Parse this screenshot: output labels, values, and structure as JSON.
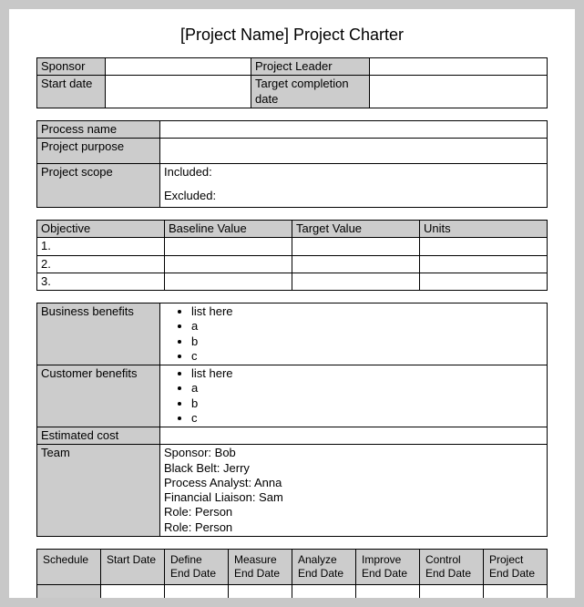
{
  "title": "[Project Name] Project Charter",
  "info": {
    "sponsorLabel": "Sponsor",
    "sponsor": "",
    "projectLeaderLabel": "Project Leader",
    "projectLeader": "",
    "startDateLabel": "Start date",
    "startDate": "",
    "targetCompletionLabel": "Target completion date",
    "targetCompletion": ""
  },
  "process": {
    "nameLabel": "Process name",
    "name": "",
    "purposeLabel": "Project purpose",
    "purpose": "",
    "scopeLabel": "Project scope",
    "includedLabel": "Included:",
    "excludedLabel": "Excluded:"
  },
  "objectives": {
    "headers": {
      "objective": "Objective",
      "baseline": "Baseline Value",
      "target": "Target Value",
      "units": "Units"
    },
    "rows": [
      {
        "num": "1.",
        "baseline": "",
        "target": "",
        "units": ""
      },
      {
        "num": "2.",
        "baseline": "",
        "target": "",
        "units": ""
      },
      {
        "num": "3.",
        "baseline": "",
        "target": "",
        "units": ""
      }
    ]
  },
  "benefits": {
    "businessLabel": "Business benefits",
    "businessItems": [
      "list here",
      "a",
      "b",
      "c"
    ],
    "customerLabel": "Customer benefits",
    "customerItems": [
      "list here",
      "a",
      "b",
      "c"
    ],
    "estimatedCostLabel": "Estimated cost",
    "estimatedCost": "",
    "teamLabel": "Team",
    "teamLines": [
      "Sponsor: Bob",
      "Black Belt: Jerry",
      "Process Analyst: Anna",
      "Financial Liaison: Sam",
      "Role: Person",
      "Role: Person"
    ]
  },
  "schedule": {
    "headers": [
      "Schedule",
      "Start Date",
      "Define End Date",
      "Measure End Date",
      "Analyze End Date",
      "Improve End Date",
      "Control End Date",
      "Project End Date"
    ],
    "row": [
      "",
      "",
      "",
      "",
      "",
      "",
      "",
      ""
    ]
  }
}
